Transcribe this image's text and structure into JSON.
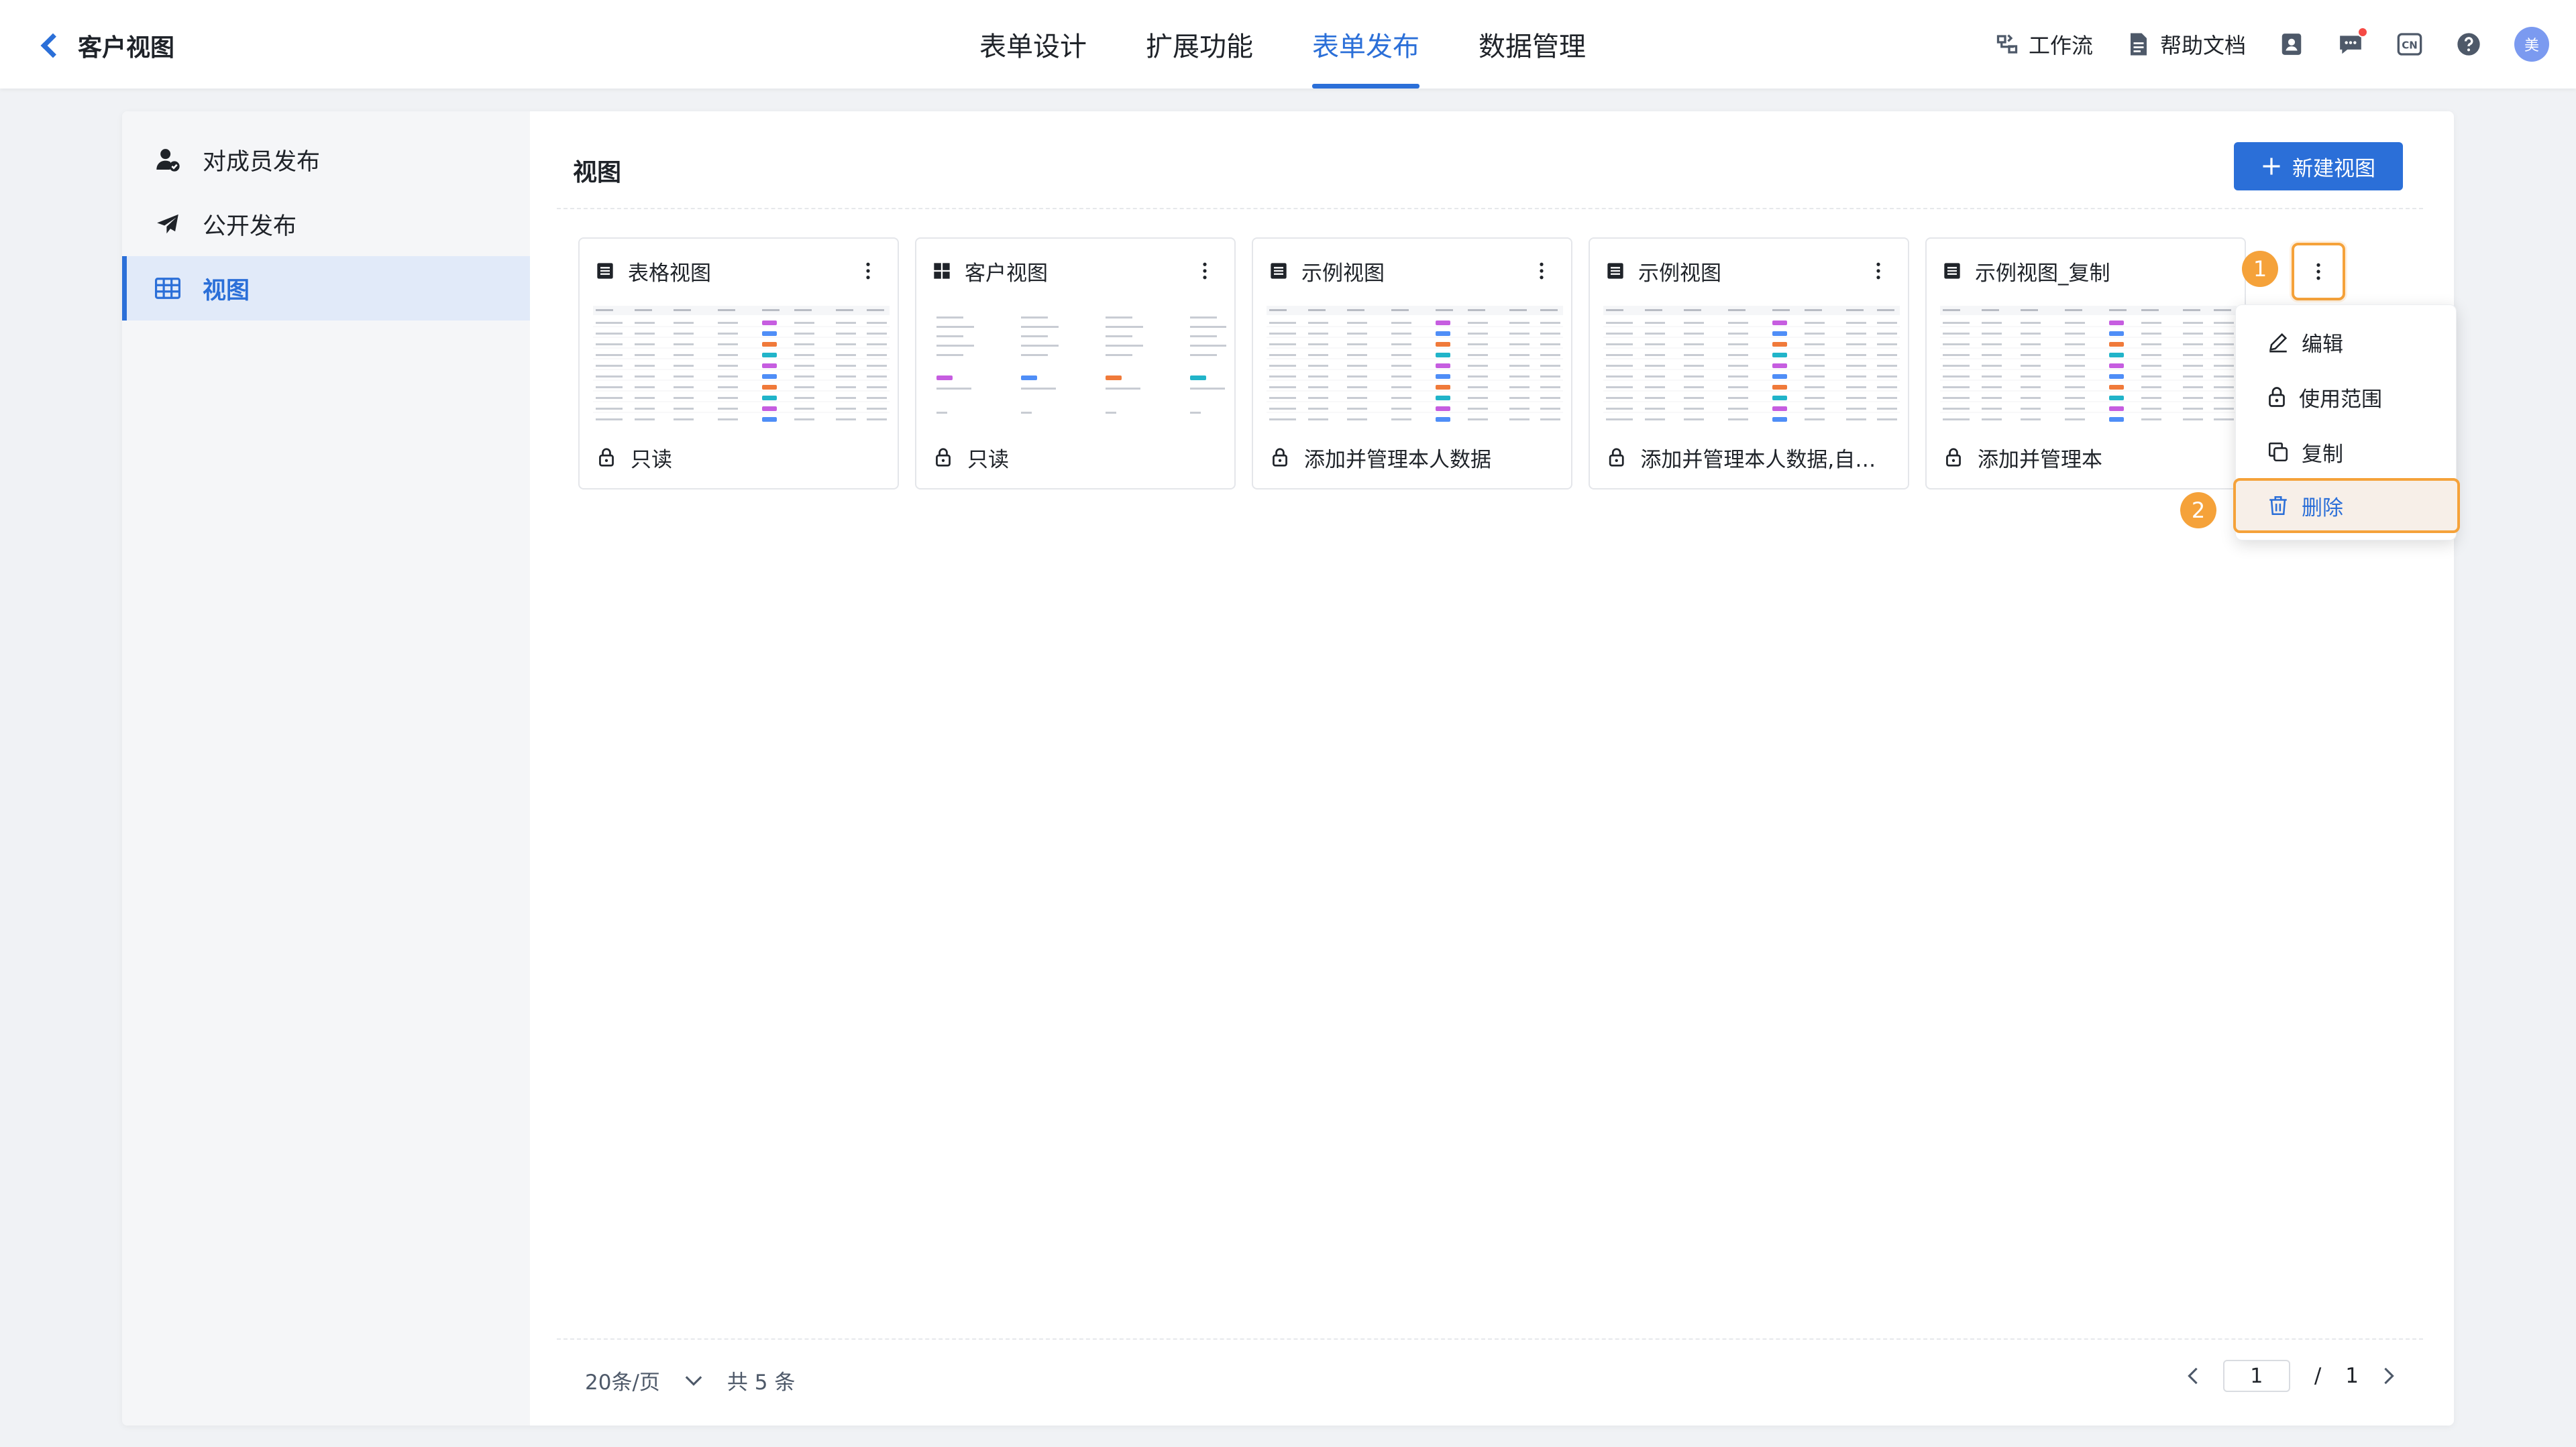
{
  "header": {
    "back_title": "客户视图",
    "tabs": [
      "表单设计",
      "扩展功能",
      "表单发布",
      "数据管理"
    ],
    "active_tab": 2,
    "workflow_label": "工作流",
    "help_label": "帮助文档",
    "lang_label": "CN",
    "avatar_text": "美"
  },
  "sidebar": {
    "items": [
      {
        "label": "对成员发布",
        "icon": "member-publish-icon"
      },
      {
        "label": "公开发布",
        "icon": "send-icon"
      },
      {
        "label": "视图",
        "icon": "table-grid-icon"
      }
    ],
    "active_index": 2
  },
  "content": {
    "title": "视图",
    "new_view_label": "新建视图"
  },
  "cards": [
    {
      "name": "表格视图",
      "type_icon": "list-view-icon",
      "permission": "只读"
    },
    {
      "name": "客户视图",
      "type_icon": "card-view-icon",
      "permission": "只读"
    },
    {
      "name": "示例视图",
      "type_icon": "list-view-icon",
      "permission": "添加并管理本人数据"
    },
    {
      "name": "示例视图",
      "type_icon": "list-view-icon",
      "permission": "添加并管理本人数据,自定..."
    },
    {
      "name": "示例视图_复制",
      "type_icon": "list-view-icon",
      "permission": "添加并管理本"
    }
  ],
  "dropdown": {
    "items": [
      "编辑",
      "使用范围",
      "复制",
      "删除"
    ]
  },
  "steps": [
    "1",
    "2"
  ],
  "pagination": {
    "page_size": "20条/页",
    "total": "共 5 条",
    "current_page": "1",
    "separator": "/",
    "total_pages": "1"
  },
  "colors": {
    "accent": "#2b6fd8",
    "highlight": "#f5a23a",
    "tag_purple": "#c65de0",
    "tag_blue": "#4f8ef7",
    "tag_orange": "#f07a3a",
    "tag_teal": "#21b4c9"
  }
}
